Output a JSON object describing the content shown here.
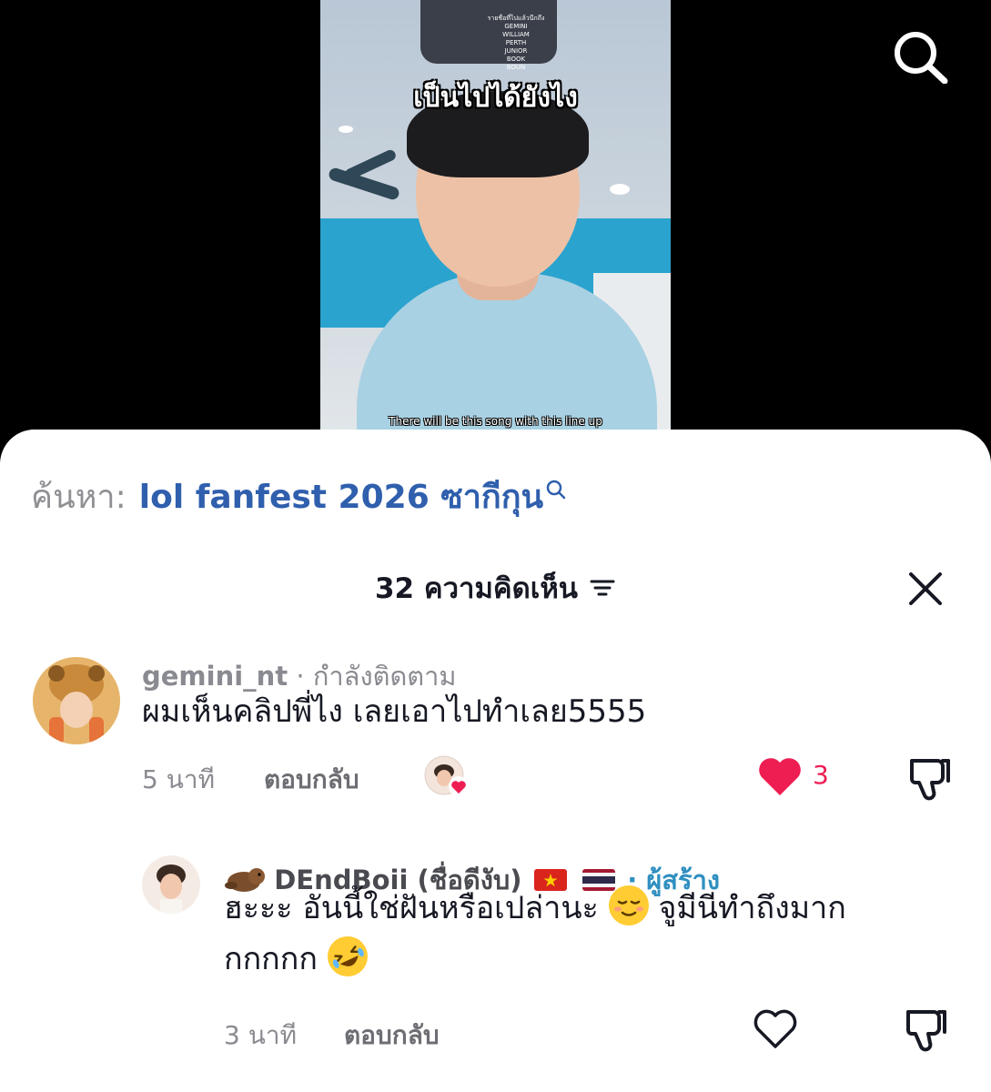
{
  "video": {
    "phone_lines": [
      "รายชื่อที่ไปแล้วนึกถึง",
      "GEMINI",
      "WILLIAM",
      "PERTH",
      "JUNIOR",
      "BOOK",
      "BOUN"
    ],
    "caption_thai": "เป็นไปได้ยังไง",
    "caption_en": "There will be this song with this line up"
  },
  "related_search": {
    "prefix": "ค้นหา:",
    "query": "lol fanfest 2026 ซากีกุน"
  },
  "comments_panel": {
    "title": "32 ความคิดเห็น"
  },
  "comments": [
    {
      "username": "gemini_nt",
      "relation": "· กำลังติดตาม",
      "text": "ผมเห็นคลิปพี่ไง เลยเอาไปทำเลย5555",
      "time": "5 นาที",
      "reply_label": "ตอบกลับ",
      "like_count": "3",
      "liked": true
    }
  ],
  "replies": [
    {
      "username": "DEndBoii (ชื่อดีงับ)",
      "creator_label": "· ผู้สร้าง",
      "text_line1": "ฮะะะ อันนี้ใช่ฝันหรือเปล่านะ",
      "text_line1b": "จูมีนีทำถึงมาก",
      "text_line2": "กกกกก",
      "time": "3 นาที",
      "reply_label": "ตอบกลับ",
      "liked": false
    }
  ],
  "colors": {
    "accent_link": "#2f5fad",
    "like_red": "#ee1d52",
    "creator_blue": "#2f8fc0"
  }
}
